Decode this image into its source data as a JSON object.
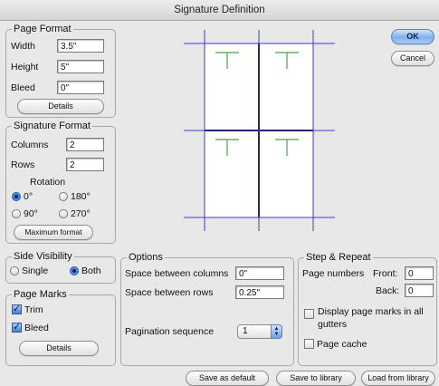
{
  "window": {
    "title": "Signature Definition"
  },
  "buttons": {
    "ok": "OK",
    "cancel": "Cancel",
    "save_default": "Save as default",
    "save_library": "Save to library",
    "load_library": "Load from library"
  },
  "page_format": {
    "legend": "Page Format",
    "width_label": "Width",
    "width_value": "3.5\"",
    "height_label": "Height",
    "height_value": "5\"",
    "bleed_label": "Bleed",
    "bleed_value": "0\"",
    "details": "Details"
  },
  "signature_format": {
    "legend": "Signature Format",
    "columns_label": "Columns",
    "columns_value": "2",
    "rows_label": "Rows",
    "rows_value": "2",
    "rotation_label": "Rotation",
    "rot_0": "0°",
    "rot_180": "180°",
    "rot_90": "90°",
    "rot_270": "270°",
    "rotation_selected": "0°",
    "max_format": "Maximum format"
  },
  "side_visibility": {
    "legend": "Side Visibility",
    "single": "Single",
    "both": "Both",
    "selected": "Both"
  },
  "page_marks": {
    "legend": "Page Marks",
    "trim": "Trim",
    "trim_checked": true,
    "bleed": "Bleed",
    "bleed_checked": true,
    "details": "Details"
  },
  "options": {
    "legend": "Options",
    "space_columns_label": "Space between columns",
    "space_columns_value": "0\"",
    "space_rows_label": "Space between rows",
    "space_rows_value": "0.25\"",
    "pagination_label": "Pagination sequence",
    "pagination_value": "1"
  },
  "step_repeat": {
    "legend": "Step & Repeat",
    "page_numbers_label": "Page numbers",
    "front_label": "Front:",
    "front_value": "0",
    "back_label": "Back:",
    "back_value": "0",
    "display_marks_label": "Display page marks in all gutters",
    "display_marks_checked": false,
    "page_cache_label": "Page cache",
    "page_cache_checked": false
  },
  "colors": {
    "accent": "#5aa0ee",
    "mark_green": "#4aa04a",
    "guide_blue": "#3b3bd6"
  }
}
